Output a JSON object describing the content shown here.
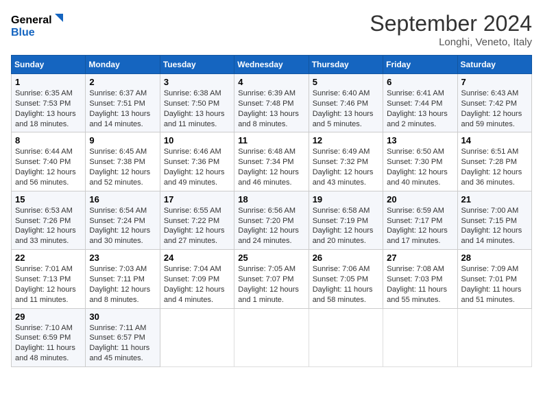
{
  "header": {
    "logo_line1": "General",
    "logo_line2": "Blue",
    "month": "September 2024",
    "location": "Longhi, Veneto, Italy"
  },
  "columns": [
    "Sunday",
    "Monday",
    "Tuesday",
    "Wednesday",
    "Thursday",
    "Friday",
    "Saturday"
  ],
  "rows": [
    [
      {
        "day": "1",
        "text": "Sunrise: 6:35 AM\nSunset: 7:53 PM\nDaylight: 13 hours and 18 minutes."
      },
      {
        "day": "2",
        "text": "Sunrise: 6:37 AM\nSunset: 7:51 PM\nDaylight: 13 hours and 14 minutes."
      },
      {
        "day": "3",
        "text": "Sunrise: 6:38 AM\nSunset: 7:50 PM\nDaylight: 13 hours and 11 minutes."
      },
      {
        "day": "4",
        "text": "Sunrise: 6:39 AM\nSunset: 7:48 PM\nDaylight: 13 hours and 8 minutes."
      },
      {
        "day": "5",
        "text": "Sunrise: 6:40 AM\nSunset: 7:46 PM\nDaylight: 13 hours and 5 minutes."
      },
      {
        "day": "6",
        "text": "Sunrise: 6:41 AM\nSunset: 7:44 PM\nDaylight: 13 hours and 2 minutes."
      },
      {
        "day": "7",
        "text": "Sunrise: 6:43 AM\nSunset: 7:42 PM\nDaylight: 12 hours and 59 minutes."
      }
    ],
    [
      {
        "day": "8",
        "text": "Sunrise: 6:44 AM\nSunset: 7:40 PM\nDaylight: 12 hours and 56 minutes."
      },
      {
        "day": "9",
        "text": "Sunrise: 6:45 AM\nSunset: 7:38 PM\nDaylight: 12 hours and 52 minutes."
      },
      {
        "day": "10",
        "text": "Sunrise: 6:46 AM\nSunset: 7:36 PM\nDaylight: 12 hours and 49 minutes."
      },
      {
        "day": "11",
        "text": "Sunrise: 6:48 AM\nSunset: 7:34 PM\nDaylight: 12 hours and 46 minutes."
      },
      {
        "day": "12",
        "text": "Sunrise: 6:49 AM\nSunset: 7:32 PM\nDaylight: 12 hours and 43 minutes."
      },
      {
        "day": "13",
        "text": "Sunrise: 6:50 AM\nSunset: 7:30 PM\nDaylight: 12 hours and 40 minutes."
      },
      {
        "day": "14",
        "text": "Sunrise: 6:51 AM\nSunset: 7:28 PM\nDaylight: 12 hours and 36 minutes."
      }
    ],
    [
      {
        "day": "15",
        "text": "Sunrise: 6:53 AM\nSunset: 7:26 PM\nDaylight: 12 hours and 33 minutes."
      },
      {
        "day": "16",
        "text": "Sunrise: 6:54 AM\nSunset: 7:24 PM\nDaylight: 12 hours and 30 minutes."
      },
      {
        "day": "17",
        "text": "Sunrise: 6:55 AM\nSunset: 7:22 PM\nDaylight: 12 hours and 27 minutes."
      },
      {
        "day": "18",
        "text": "Sunrise: 6:56 AM\nSunset: 7:20 PM\nDaylight: 12 hours and 24 minutes."
      },
      {
        "day": "19",
        "text": "Sunrise: 6:58 AM\nSunset: 7:19 PM\nDaylight: 12 hours and 20 minutes."
      },
      {
        "day": "20",
        "text": "Sunrise: 6:59 AM\nSunset: 7:17 PM\nDaylight: 12 hours and 17 minutes."
      },
      {
        "day": "21",
        "text": "Sunrise: 7:00 AM\nSunset: 7:15 PM\nDaylight: 12 hours and 14 minutes."
      }
    ],
    [
      {
        "day": "22",
        "text": "Sunrise: 7:01 AM\nSunset: 7:13 PM\nDaylight: 12 hours and 11 minutes."
      },
      {
        "day": "23",
        "text": "Sunrise: 7:03 AM\nSunset: 7:11 PM\nDaylight: 12 hours and 8 minutes."
      },
      {
        "day": "24",
        "text": "Sunrise: 7:04 AM\nSunset: 7:09 PM\nDaylight: 12 hours and 4 minutes."
      },
      {
        "day": "25",
        "text": "Sunrise: 7:05 AM\nSunset: 7:07 PM\nDaylight: 12 hours and 1 minute."
      },
      {
        "day": "26",
        "text": "Sunrise: 7:06 AM\nSunset: 7:05 PM\nDaylight: 11 hours and 58 minutes."
      },
      {
        "day": "27",
        "text": "Sunrise: 7:08 AM\nSunset: 7:03 PM\nDaylight: 11 hours and 55 minutes."
      },
      {
        "day": "28",
        "text": "Sunrise: 7:09 AM\nSunset: 7:01 PM\nDaylight: 11 hours and 51 minutes."
      }
    ],
    [
      {
        "day": "29",
        "text": "Sunrise: 7:10 AM\nSunset: 6:59 PM\nDaylight: 11 hours and 48 minutes."
      },
      {
        "day": "30",
        "text": "Sunrise: 7:11 AM\nSunset: 6:57 PM\nDaylight: 11 hours and 45 minutes."
      },
      {
        "day": "",
        "text": ""
      },
      {
        "day": "",
        "text": ""
      },
      {
        "day": "",
        "text": ""
      },
      {
        "day": "",
        "text": ""
      },
      {
        "day": "",
        "text": ""
      }
    ]
  ]
}
